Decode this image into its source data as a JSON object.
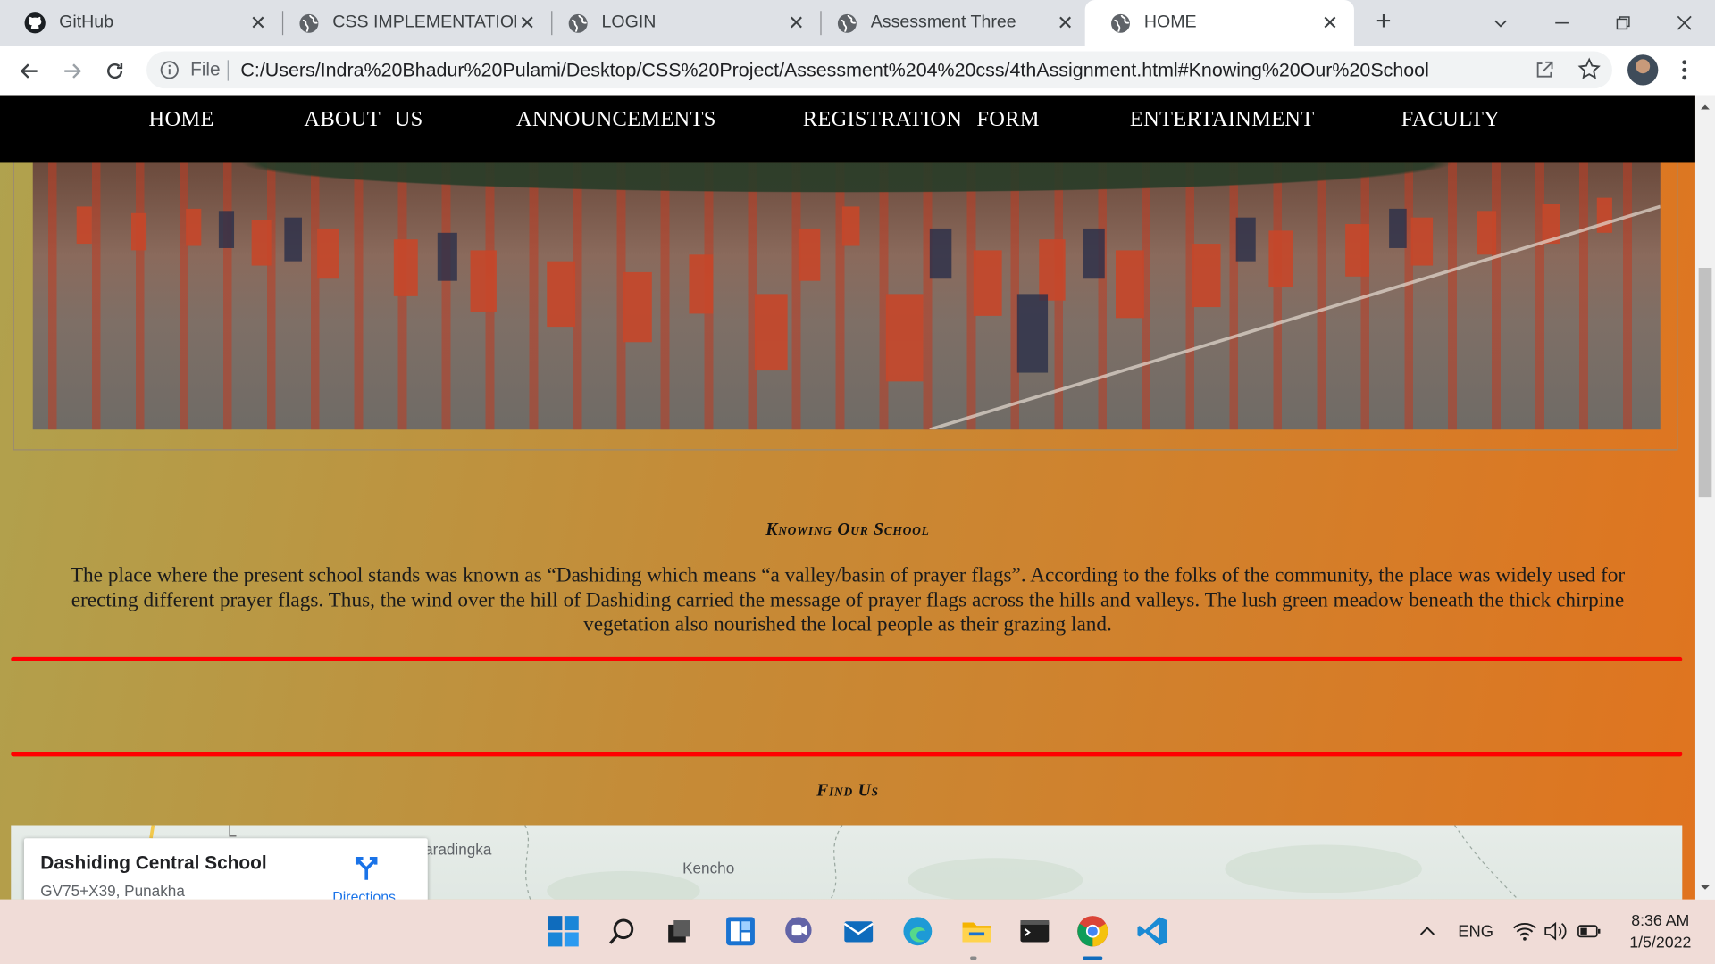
{
  "browser": {
    "tabs": [
      {
        "label": "GitHub",
        "icon": "github-icon",
        "active": false
      },
      {
        "label": "CSS IMPLEMENTATION",
        "icon": "globe-icon",
        "active": false
      },
      {
        "label": "LOGIN",
        "icon": "globe-icon",
        "active": false
      },
      {
        "label": "Assessment Three",
        "icon": "globe-icon",
        "active": false
      },
      {
        "label": "HOME",
        "icon": "globe-icon",
        "active": true
      }
    ],
    "new_tab": "+",
    "address": {
      "scheme_label": "File",
      "url": "C:/Users/Indra%20Bhadur%20Pulami/Desktop/CSS%20Project/Assessment%204%20css/4thAssignment.html#Knowing%20Our%20School"
    }
  },
  "page": {
    "nav": [
      "HOME",
      "ABOUT US",
      "ANNOUNCEMENTS",
      "REGISTRATION FORM",
      "ENTERTAINMENT",
      "FACULTY"
    ],
    "section_title": "Knowing Our School",
    "paragraph": "The place where the present school stands was known as “Dashiding which means “a valley/basin of prayer flags”. According to the folks of the community, the place was widely used for erecting different prayer flags. Thus, the wind over the hill of Dashiding carried the message of prayer flags across the hills and valleys. The lush green meadow beneath the thick chirpine vegetation also nourished the local people as their grazing land.",
    "find_title": "Find Us",
    "map": {
      "place_name": "Dashiding Central School",
      "address": "GV75+X39, Punakha",
      "directions": "Directions",
      "labels": [
        "aradingka",
        "Kencho"
      ]
    },
    "accent_colors": {
      "rule": "#ff0000",
      "nav_bg": "#000000",
      "gradient_left": "#b0a24e",
      "gradient_right": "#e0741f"
    }
  },
  "taskbar": {
    "apps": [
      "windows-start-icon",
      "search-icon",
      "task-view-icon",
      "widgets-icon",
      "teams-chat-icon",
      "mail-icon",
      "edge-icon",
      "file-explorer-icon",
      "terminal-icon",
      "chrome-icon",
      "vscode-icon"
    ],
    "language": "ENG",
    "time": "8:36 AM",
    "date": "1/5/2022"
  }
}
